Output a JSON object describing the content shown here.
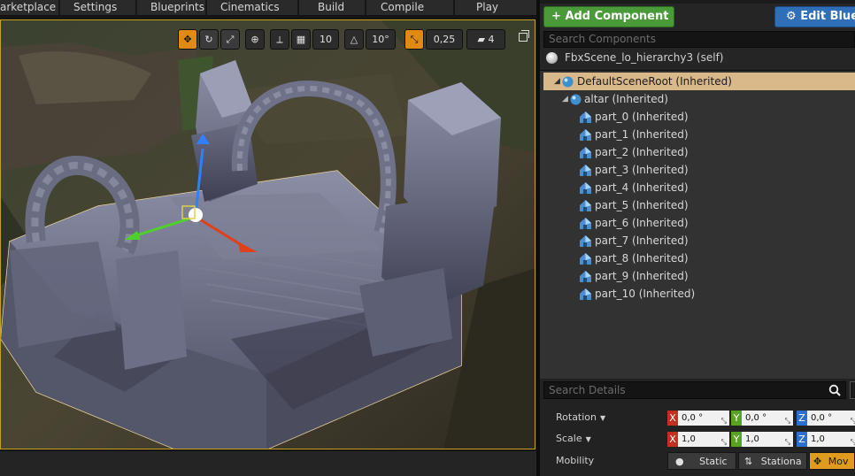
{
  "menubar": {
    "items": [
      "arketplace",
      "Settings",
      "Blueprints",
      "Cinematics",
      "Build",
      "Compile",
      "Play"
    ]
  },
  "viewport": {
    "toolbar": {
      "grid_snap": "10",
      "rotation_snap": "10°",
      "scale_snap": "0,25",
      "camera_speed": "4"
    }
  },
  "components": {
    "add_button": "Add Component",
    "edit_button": "Edit Blue",
    "search_placeholder": "Search Components",
    "self_label": "FbxScene_lo_hierarchy3 (self)",
    "tree": [
      {
        "label": "DefaultSceneRoot (Inherited)",
        "level": 0,
        "selected": true
      },
      {
        "label": "altar (Inherited)",
        "level": 1,
        "selected": false
      },
      {
        "label": "part_0 (Inherited)",
        "level": 2,
        "selected": false
      },
      {
        "label": "part_1 (Inherited)",
        "level": 2,
        "selected": false
      },
      {
        "label": "part_2 (Inherited)",
        "level": 2,
        "selected": false
      },
      {
        "label": "part_3 (Inherited)",
        "level": 2,
        "selected": false
      },
      {
        "label": "part_4 (Inherited)",
        "level": 2,
        "selected": false
      },
      {
        "label": "part_5 (Inherited)",
        "level": 2,
        "selected": false
      },
      {
        "label": "part_6 (Inherited)",
        "level": 2,
        "selected": false
      },
      {
        "label": "part_7 (Inherited)",
        "level": 2,
        "selected": false
      },
      {
        "label": "part_8 (Inherited)",
        "level": 2,
        "selected": false
      },
      {
        "label": "part_9 (Inherited)",
        "level": 2,
        "selected": false
      },
      {
        "label": "part_10 (Inherited)",
        "level": 2,
        "selected": false
      }
    ]
  },
  "details": {
    "search_placeholder": "Search Details",
    "rotation": {
      "label": "Rotation",
      "x": "0,0 °",
      "y": "0,0 °",
      "z": "0,0 °"
    },
    "scale": {
      "label": "Scale",
      "x": "1,0",
      "y": "1,0",
      "z": "1,0"
    },
    "mobility": {
      "label": "Mobility",
      "options": [
        "Static",
        "Stationa",
        "Mov"
      ],
      "selected": "Mov"
    }
  },
  "colors": {
    "add_green": "#4a9a3a",
    "edit_blue": "#2f6fb8",
    "selection_tan": "#d9b88a",
    "accent_orange": "#e08a14"
  }
}
